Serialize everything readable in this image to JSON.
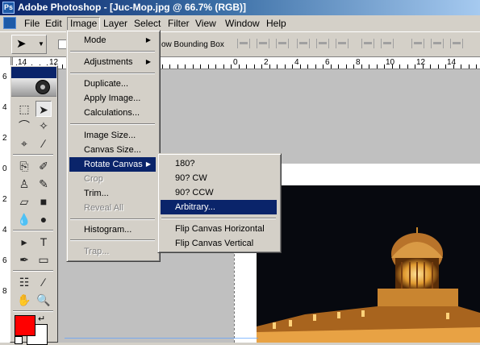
{
  "window": {
    "title": "Adobe Photoshop - [Juc-Mop.jpg @ 66.7% (RGB)]"
  },
  "menubar": [
    {
      "label": "File",
      "active": false
    },
    {
      "label": "Edit",
      "active": false
    },
    {
      "label": "Image",
      "active": true
    },
    {
      "label": "Layer",
      "active": false
    },
    {
      "label": "Select",
      "active": false
    },
    {
      "label": "Filter",
      "active": false
    },
    {
      "label": "View",
      "active": false
    },
    {
      "label": "Window",
      "active": false
    },
    {
      "label": "Help",
      "active": false
    }
  ],
  "options": {
    "bounding_box_label": "ow Bounding Box"
  },
  "image_menu": {
    "items": [
      {
        "label": "Mode",
        "submenu": true,
        "disabled": false
      },
      {
        "label": "Adjustments",
        "submenu": true,
        "disabled": false
      },
      {
        "label": "Duplicate...",
        "submenu": false,
        "disabled": false
      },
      {
        "label": "Apply Image...",
        "submenu": false,
        "disabled": false
      },
      {
        "label": "Calculations...",
        "submenu": false,
        "disabled": false
      },
      {
        "label": "Image Size...",
        "submenu": false,
        "disabled": false
      },
      {
        "label": "Canvas Size...",
        "submenu": false,
        "disabled": false
      },
      {
        "label": "Rotate Canvas",
        "submenu": true,
        "disabled": false,
        "highlighted": true
      },
      {
        "label": "Crop",
        "submenu": false,
        "disabled": true
      },
      {
        "label": "Trim...",
        "submenu": false,
        "disabled": false
      },
      {
        "label": "Reveal All",
        "submenu": false,
        "disabled": true
      },
      {
        "label": "Histogram...",
        "submenu": false,
        "disabled": false
      },
      {
        "label": "Trap...",
        "submenu": false,
        "disabled": true
      }
    ]
  },
  "rotate_menu": {
    "items": [
      {
        "label": "180?"
      },
      {
        "label": "90? CW"
      },
      {
        "label": "90? CCW"
      },
      {
        "label": "Arbitrary...",
        "highlighted": true
      },
      {
        "label": "Flip Canvas Horizontal"
      },
      {
        "label": "Flip Canvas Vertical"
      }
    ]
  },
  "ruler": {
    "h_labels": [
      "14",
      "12",
      "0",
      "2",
      "4",
      "6",
      "8",
      "10",
      "12",
      "14"
    ],
    "v_labels": [
      "6",
      "4",
      "2",
      "0",
      "2",
      "4",
      "6",
      "8"
    ]
  },
  "colors": {
    "foreground": "#ff0000",
    "background": "#ffffff",
    "highlight": "#0a246a",
    "title_bar": "#0a246a"
  }
}
